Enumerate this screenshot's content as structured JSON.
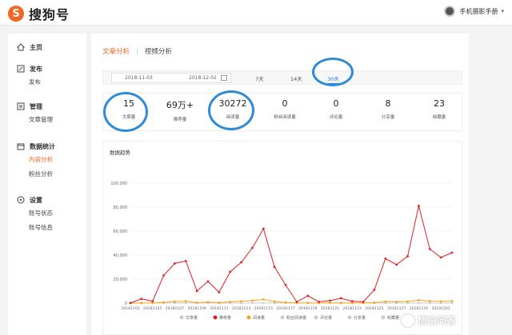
{
  "header": {
    "logo_text": "搜狗号",
    "logo_letter": "S",
    "user_name": "手机摄影手册",
    "caret": "▾"
  },
  "sidebar": {
    "groups": [
      {
        "label": "主页",
        "icon": "home-icon",
        "items": []
      },
      {
        "label": "发布",
        "icon": "edit-icon",
        "items": [
          {
            "label": "发布"
          }
        ]
      },
      {
        "label": "管理",
        "icon": "list-icon",
        "items": [
          {
            "label": "文章管理"
          }
        ]
      },
      {
        "label": "数据统计",
        "icon": "calendar-icon",
        "items": [
          {
            "label": "内容分析",
            "active": true
          },
          {
            "label": "粉丝分析"
          }
        ]
      },
      {
        "label": "设置",
        "icon": "settings-icon",
        "items": [
          {
            "label": "账号状态"
          },
          {
            "label": "账号信息"
          }
        ]
      }
    ]
  },
  "tabs": {
    "article": "文章分析",
    "separator": "|",
    "video": "视频分析"
  },
  "filter": {
    "start_date": "2018-11-03",
    "end_date": "2018-12-02",
    "ranges": [
      "7天",
      "14天",
      "30天"
    ],
    "active_range": "30天"
  },
  "stats": [
    {
      "value": "15",
      "label": "文章量"
    },
    {
      "value": "69万+",
      "label": "推荐量"
    },
    {
      "value": "30272",
      "label": "阅读量"
    },
    {
      "value": "0",
      "label": "粉丝阅读量"
    },
    {
      "value": "0",
      "label": "评论量"
    },
    {
      "value": "8",
      "label": "分享量"
    },
    {
      "value": "23",
      "label": "收藏量"
    }
  ],
  "chart_title": "数据趋势",
  "chart_data": {
    "type": "line",
    "y_ticks": [
      "100,000",
      "80,000",
      "60,000",
      "40,000",
      "20,000",
      "0"
    ],
    "ylim": [
      0,
      100000
    ],
    "x": [
      "20181103",
      "20181104",
      "20181105",
      "20181106",
      "20181107",
      "20181108",
      "20181109",
      "20181110",
      "20181111",
      "20181112",
      "20181113",
      "20181114",
      "20181115",
      "20181116",
      "20181117",
      "20181118",
      "20181119",
      "20181120",
      "20181121",
      "20181122",
      "20181123",
      "20181124",
      "20181125",
      "20181126",
      "20181127",
      "20181128",
      "20181129",
      "20181130",
      "20181201",
      "20181202"
    ],
    "x_tick_labels": [
      "20181103",
      "20181105",
      "20181107",
      "20181109",
      "20181111",
      "20181113",
      "20181115",
      "20181117",
      "20181119",
      "20181121",
      "20181123",
      "20181125",
      "20181127",
      "20181129",
      "20181201"
    ],
    "series": [
      {
        "name": "推荐量",
        "color": "#e02020",
        "values": [
          0,
          3500,
          1500,
          23000,
          33000,
          35000,
          10000,
          18000,
          9000,
          26000,
          34000,
          46000,
          62000,
          30000,
          15000,
          1000,
          6000,
          1000,
          2000,
          4000,
          1500,
          1000,
          11000,
          37000,
          32000,
          39000,
          81000,
          45000,
          38000,
          42000
        ]
      },
      {
        "name": "阅读量",
        "color": "#f5a623",
        "values": [
          0,
          100,
          50,
          600,
          1200,
          1500,
          300,
          800,
          300,
          1000,
          1400,
          2000,
          3000,
          1200,
          500,
          50,
          200,
          50,
          100,
          150,
          50,
          50,
          300,
          1200,
          1000,
          1300,
          2400,
          1600,
          1400,
          1600
        ]
      },
      {
        "name": "文章量",
        "color": "#cccccc",
        "values": [
          0,
          0,
          0,
          0,
          0,
          0,
          0,
          0,
          0,
          0,
          0,
          0,
          0,
          0,
          0,
          0,
          0,
          0,
          0,
          0,
          0,
          0,
          0,
          0,
          0,
          0,
          0,
          0,
          0,
          0
        ]
      }
    ],
    "legend": [
      "文章量",
      "推荐量",
      "阅读量",
      "粉丝阅读量",
      "评论量",
      "分享量",
      "收藏量"
    ],
    "legend_colors": [
      "#cccccc",
      "#e02020",
      "#f5a623",
      "#cccccc",
      "#cccccc",
      "#cccccc",
      "#cccccc"
    ]
  },
  "watermark": "悟空问答"
}
